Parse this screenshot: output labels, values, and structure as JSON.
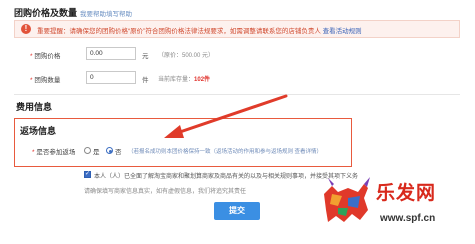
{
  "price_section": {
    "title": "团购价格及数量",
    "hint_link": "我要帮助填写帮助"
  },
  "notice": {
    "icon": "warning-icon",
    "text": "重要提醒：请确保您的团购价格“原价”符合团购价格法律法规要求，如需调整请联系您的店铺负责人",
    "link": "查看活动规则"
  },
  "price_field": {
    "label": "团购价格",
    "value": "0.00",
    "unit": "元",
    "note": "（原价：500.00 元）"
  },
  "qty_field": {
    "label": "团购数量",
    "value": "0",
    "unit": "件",
    "stock_label": "当前库存量：",
    "stock_value": "102件"
  },
  "fee_section": {
    "title": "费用信息"
  },
  "rebate_section": {
    "title": "返场信息",
    "field_label": "是否参加返场",
    "option_yes": "是",
    "option_no": "否",
    "selected": "否",
    "hint": "（若报名成功则本团价格保持一致（返场活动的作用和参与返场规则 查看详情）"
  },
  "agreement": {
    "text": "本人（人）已全面了解淘宝商家和聚划算商家及商品有关的以及与相关规则事项，并接受其项下义务",
    "sub": "请确保填写商家信息真实，如有虚假信息，我们将追究其责任"
  },
  "submit_label": "提交",
  "watermark": {
    "brand": "乐发网",
    "url": "www.spf.cn"
  },
  "colors": {
    "accent_red": "#e85a3e",
    "button_blue": "#3b8fe3",
    "notice_bg": "#fdf1ee"
  }
}
